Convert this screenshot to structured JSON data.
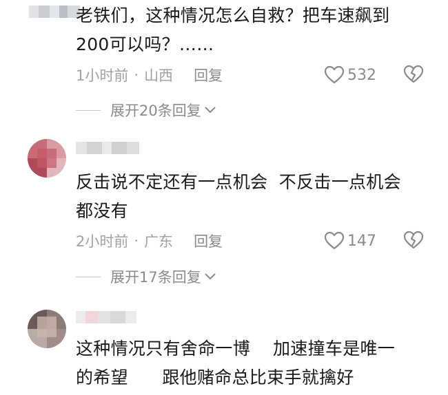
{
  "comments": [
    {
      "text": "老铁们，这种情况怎么自救？把车速飙到\n200可以吗？……",
      "time": "1小时前",
      "location": "山西",
      "reply_label": "回复",
      "likes": "532",
      "expand_label": "展开20条回复"
    },
    {
      "text": "反击说不定还有一点机会  不反击一点机会\n都没有",
      "time": "2小时前",
      "location": "广东",
      "reply_label": "回复",
      "likes": "147",
      "expand_label": "展开17条回复"
    },
    {
      "text": "这种情况只有舍命一博    加速撞车是唯一\n的希望      跟他赌命总比束手就擒好"
    }
  ],
  "separator": "·",
  "icons": {
    "like": "heart-outline-icon",
    "dislike": "broken-heart-icon",
    "expand": "chevron-down-icon"
  },
  "colors": {
    "text": "#1a1a1a",
    "meta": "#a2a2a2",
    "secondary": "#8a8a8a"
  }
}
